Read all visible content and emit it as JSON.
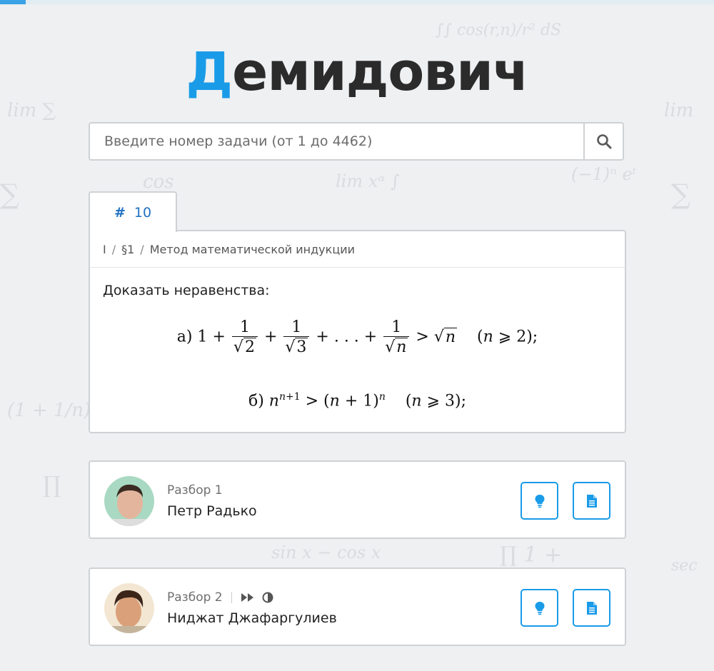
{
  "logo": {
    "first_letter": "Д",
    "rest": "емидович"
  },
  "search": {
    "placeholder": "Введите номер задачи (от 1 до 4462)",
    "value": ""
  },
  "tab": {
    "hash": "#",
    "number": "10"
  },
  "problem": {
    "breadcrumb": [
      "I",
      "§1",
      "Метод математической индукции"
    ],
    "statement": "Доказать неравенства:",
    "formula_a_label": "а)",
    "formula_b_label": "б)"
  },
  "solutions": [
    {
      "label": "Разбор 1",
      "author": "Петр Радько"
    },
    {
      "label": "Разбор 2",
      "author": "Ниджат Джафаргулиев"
    }
  ],
  "icons": {
    "search": "search-icon",
    "hint": "lightbulb-icon",
    "doc": "document-icon",
    "fast_forward": "fast-forward-icon",
    "contrast": "half-circle-icon"
  },
  "colors": {
    "accent": "#1a9be8",
    "tab_text": "#1f72c2",
    "background": "#eef0f2"
  }
}
